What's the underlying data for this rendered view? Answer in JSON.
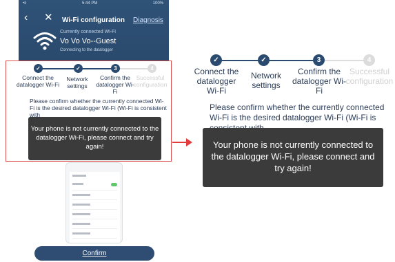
{
  "status_bar": {
    "carrier": "•ıl",
    "time": "5:44 PM",
    "battery": "100%"
  },
  "header": {
    "back_icon": "back-chevron-icon",
    "close_icon": "close-icon",
    "title": "Wi-Fi configuration",
    "diagnosis": "Diagnosis",
    "connected_caption": "Currently connected Wi-Fi",
    "wifi_name": "Vo Vo Vo--Guest",
    "wifi_sub": "Connecting to the datalogger"
  },
  "steps": [
    {
      "num": "✓",
      "label": "Connect the datalogger Wi-Fi",
      "state": "done"
    },
    {
      "num": "✓",
      "label": "Network settings",
      "state": "done"
    },
    {
      "num": "3",
      "label": "Confirm the datalogger Wi-Fi",
      "state": "current"
    },
    {
      "num": "4",
      "label": "Successful configuration",
      "state": "pending"
    }
  ],
  "message": "Please confirm whether the currently connected Wi-Fi is the desired datalogger Wi-Fi (Wi-Fi is consistent with",
  "toast": "Your phone is not currently connected to the datalogger Wi-Fi, please connect and try again!",
  "confirm_button": "Confirm",
  "colors": {
    "primary": "#2b4a6f",
    "toast": "#3b3b3b",
    "accent_red": "#e23b3b"
  }
}
